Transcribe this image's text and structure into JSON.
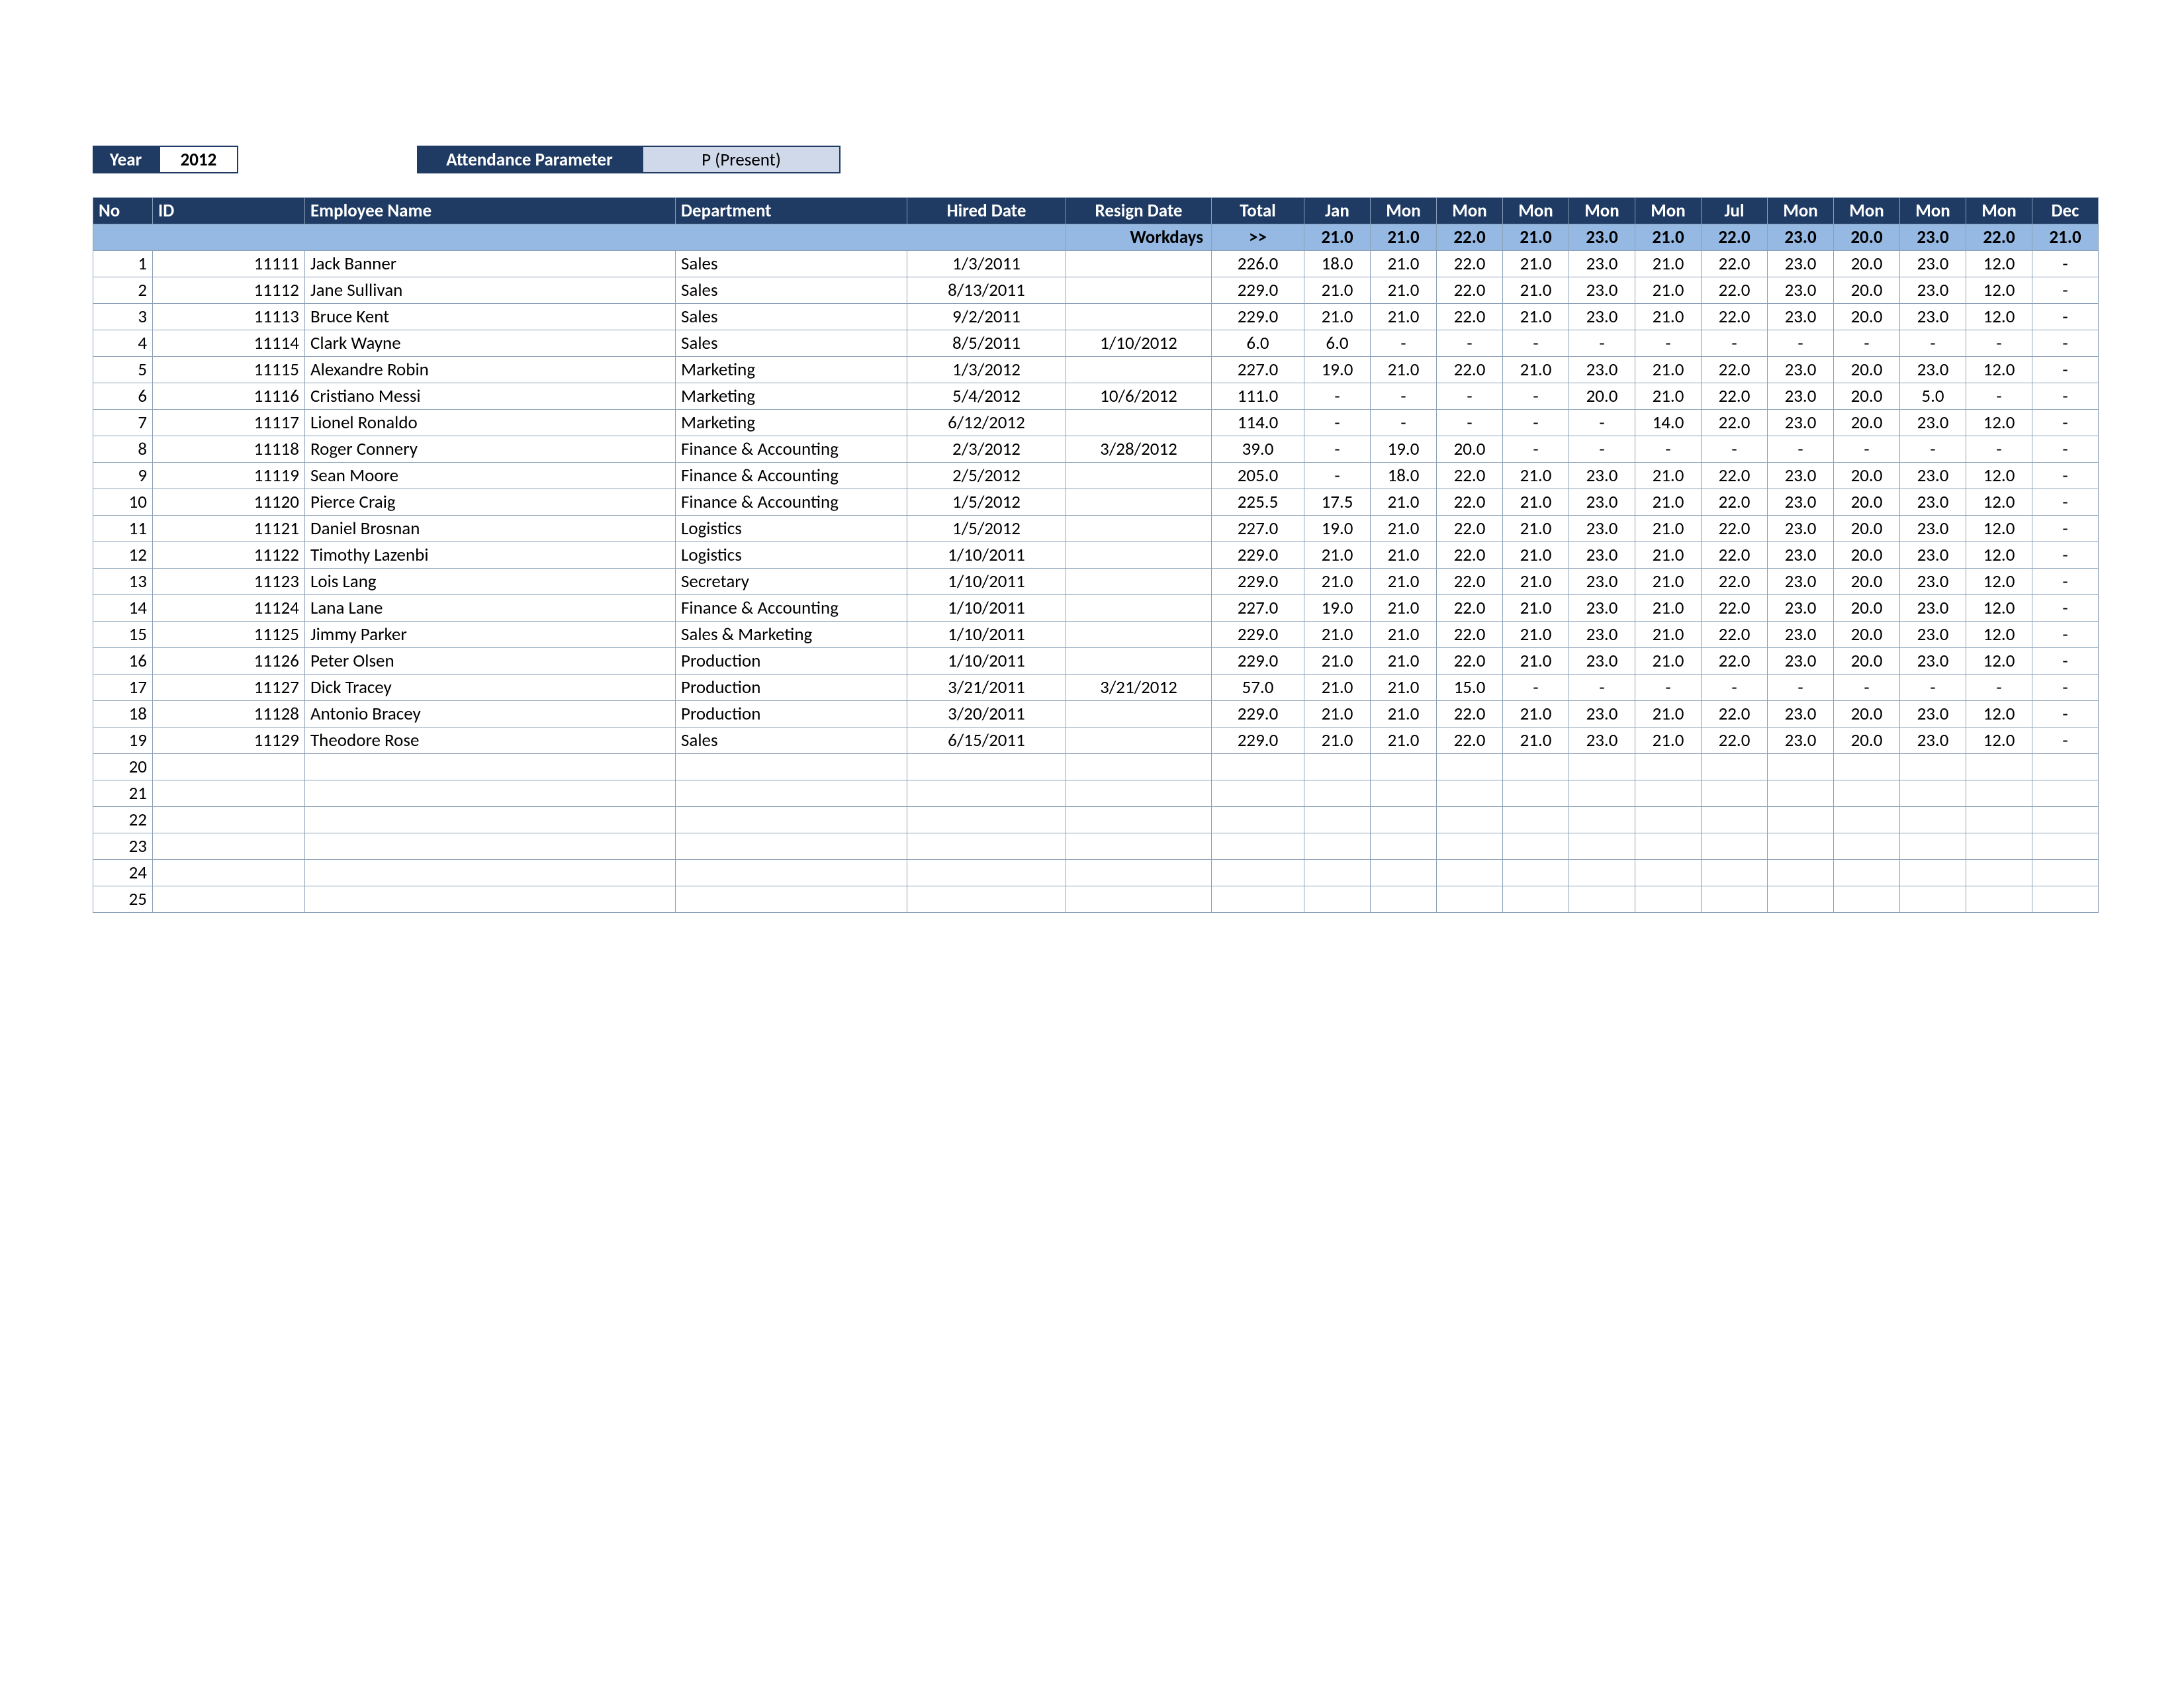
{
  "controls": {
    "year_label": "Year",
    "year_value": "2012",
    "attendance_label": "Attendance Parameter",
    "attendance_value": "P (Present)"
  },
  "columns": [
    "No",
    "ID",
    "Employee Name",
    "Department",
    "Hired Date",
    "Resign Date",
    "Total",
    "Jan",
    "Mon",
    "Mon",
    "Mon",
    "Mon",
    "Mon",
    "Jul",
    "Mon",
    "Mon",
    "Mon",
    "Mon",
    "Dec"
  ],
  "workdays": {
    "label": "Workdays",
    "total": ">>",
    "months": [
      "21.0",
      "21.0",
      "22.0",
      "21.0",
      "23.0",
      "21.0",
      "22.0",
      "23.0",
      "20.0",
      "23.0",
      "22.0",
      "21.0"
    ]
  },
  "rows": [
    {
      "no": 1,
      "id": "11111",
      "name": "Jack Banner",
      "dept": "Sales",
      "hired": "1/3/2011",
      "resign": "",
      "total": "226.0",
      "m": [
        "18.0",
        "21.0",
        "22.0",
        "21.0",
        "23.0",
        "21.0",
        "22.0",
        "23.0",
        "20.0",
        "23.0",
        "12.0",
        "-"
      ]
    },
    {
      "no": 2,
      "id": "11112",
      "name": "Jane Sullivan",
      "dept": "Sales",
      "hired": "8/13/2011",
      "resign": "",
      "total": "229.0",
      "m": [
        "21.0",
        "21.0",
        "22.0",
        "21.0",
        "23.0",
        "21.0",
        "22.0",
        "23.0",
        "20.0",
        "23.0",
        "12.0",
        "-"
      ]
    },
    {
      "no": 3,
      "id": "11113",
      "name": "Bruce Kent",
      "dept": "Sales",
      "hired": "9/2/2011",
      "resign": "",
      "total": "229.0",
      "m": [
        "21.0",
        "21.0",
        "22.0",
        "21.0",
        "23.0",
        "21.0",
        "22.0",
        "23.0",
        "20.0",
        "23.0",
        "12.0",
        "-"
      ]
    },
    {
      "no": 4,
      "id": "11114",
      "name": "Clark Wayne",
      "dept": "Sales",
      "hired": "8/5/2011",
      "resign": "1/10/2012",
      "total": "6.0",
      "m": [
        "6.0",
        "-",
        "-",
        "-",
        "-",
        "-",
        "-",
        "-",
        "-",
        "-",
        "-",
        "-"
      ]
    },
    {
      "no": 5,
      "id": "11115",
      "name": "Alexandre Robin",
      "dept": "Marketing",
      "hired": "1/3/2012",
      "resign": "",
      "total": "227.0",
      "m": [
        "19.0",
        "21.0",
        "22.0",
        "21.0",
        "23.0",
        "21.0",
        "22.0",
        "23.0",
        "20.0",
        "23.0",
        "12.0",
        "-"
      ]
    },
    {
      "no": 6,
      "id": "11116",
      "name": "Cristiano Messi",
      "dept": "Marketing",
      "hired": "5/4/2012",
      "resign": "10/6/2012",
      "total": "111.0",
      "m": [
        "-",
        "-",
        "-",
        "-",
        "20.0",
        "21.0",
        "22.0",
        "23.0",
        "20.0",
        "5.0",
        "-",
        "-"
      ]
    },
    {
      "no": 7,
      "id": "11117",
      "name": "Lionel Ronaldo",
      "dept": "Marketing",
      "hired": "6/12/2012",
      "resign": "",
      "total": "114.0",
      "m": [
        "-",
        "-",
        "-",
        "-",
        "-",
        "14.0",
        "22.0",
        "23.0",
        "20.0",
        "23.0",
        "12.0",
        "-"
      ]
    },
    {
      "no": 8,
      "id": "11118",
      "name": "Roger Connery",
      "dept": "Finance & Accounting",
      "hired": "2/3/2012",
      "resign": "3/28/2012",
      "total": "39.0",
      "m": [
        "-",
        "19.0",
        "20.0",
        "-",
        "-",
        "-",
        "-",
        "-",
        "-",
        "-",
        "-",
        "-"
      ]
    },
    {
      "no": 9,
      "id": "11119",
      "name": "Sean Moore",
      "dept": "Finance & Accounting",
      "hired": "2/5/2012",
      "resign": "",
      "total": "205.0",
      "m": [
        "-",
        "18.0",
        "22.0",
        "21.0",
        "23.0",
        "21.0",
        "22.0",
        "23.0",
        "20.0",
        "23.0",
        "12.0",
        "-"
      ]
    },
    {
      "no": 10,
      "id": "11120",
      "name": "Pierce Craig",
      "dept": "Finance & Accounting",
      "hired": "1/5/2012",
      "resign": "",
      "total": "225.5",
      "m": [
        "17.5",
        "21.0",
        "22.0",
        "21.0",
        "23.0",
        "21.0",
        "22.0",
        "23.0",
        "20.0",
        "23.0",
        "12.0",
        "-"
      ]
    },
    {
      "no": 11,
      "id": "11121",
      "name": "Daniel Brosnan",
      "dept": "Logistics",
      "hired": "1/5/2012",
      "resign": "",
      "total": "227.0",
      "m": [
        "19.0",
        "21.0",
        "22.0",
        "21.0",
        "23.0",
        "21.0",
        "22.0",
        "23.0",
        "20.0",
        "23.0",
        "12.0",
        "-"
      ]
    },
    {
      "no": 12,
      "id": "11122",
      "name": "Timothy Lazenbi",
      "dept": "Logistics",
      "hired": "1/10/2011",
      "resign": "",
      "total": "229.0",
      "m": [
        "21.0",
        "21.0",
        "22.0",
        "21.0",
        "23.0",
        "21.0",
        "22.0",
        "23.0",
        "20.0",
        "23.0",
        "12.0",
        "-"
      ]
    },
    {
      "no": 13,
      "id": "11123",
      "name": "Lois Lang",
      "dept": "Secretary",
      "hired": "1/10/2011",
      "resign": "",
      "total": "229.0",
      "m": [
        "21.0",
        "21.0",
        "22.0",
        "21.0",
        "23.0",
        "21.0",
        "22.0",
        "23.0",
        "20.0",
        "23.0",
        "12.0",
        "-"
      ]
    },
    {
      "no": 14,
      "id": "11124",
      "name": "Lana Lane",
      "dept": "Finance & Accounting",
      "hired": "1/10/2011",
      "resign": "",
      "total": "227.0",
      "m": [
        "19.0",
        "21.0",
        "22.0",
        "21.0",
        "23.0",
        "21.0",
        "22.0",
        "23.0",
        "20.0",
        "23.0",
        "12.0",
        "-"
      ]
    },
    {
      "no": 15,
      "id": "11125",
      "name": "Jimmy Parker",
      "dept": "Sales & Marketing",
      "hired": "1/10/2011",
      "resign": "",
      "total": "229.0",
      "m": [
        "21.0",
        "21.0",
        "22.0",
        "21.0",
        "23.0",
        "21.0",
        "22.0",
        "23.0",
        "20.0",
        "23.0",
        "12.0",
        "-"
      ]
    },
    {
      "no": 16,
      "id": "11126",
      "name": "Peter Olsen",
      "dept": "Production",
      "hired": "1/10/2011",
      "resign": "",
      "total": "229.0",
      "m": [
        "21.0",
        "21.0",
        "22.0",
        "21.0",
        "23.0",
        "21.0",
        "22.0",
        "23.0",
        "20.0",
        "23.0",
        "12.0",
        "-"
      ]
    },
    {
      "no": 17,
      "id": "11127",
      "name": "Dick Tracey",
      "dept": "Production",
      "hired": "3/21/2011",
      "resign": "3/21/2012",
      "total": "57.0",
      "m": [
        "21.0",
        "21.0",
        "15.0",
        "-",
        "-",
        "-",
        "-",
        "-",
        "-",
        "-",
        "-",
        "-"
      ]
    },
    {
      "no": 18,
      "id": "11128",
      "name": "Antonio Bracey",
      "dept": "Production",
      "hired": "3/20/2011",
      "resign": "",
      "total": "229.0",
      "m": [
        "21.0",
        "21.0",
        "22.0",
        "21.0",
        "23.0",
        "21.0",
        "22.0",
        "23.0",
        "20.0",
        "23.0",
        "12.0",
        "-"
      ]
    },
    {
      "no": 19,
      "id": "11129",
      "name": "Theodore Rose",
      "dept": "Sales",
      "hired": "6/15/2011",
      "resign": "",
      "total": "229.0",
      "m": [
        "21.0",
        "21.0",
        "22.0",
        "21.0",
        "23.0",
        "21.0",
        "22.0",
        "23.0",
        "20.0",
        "23.0",
        "12.0",
        "-"
      ]
    }
  ],
  "empty_rows": [
    20,
    21,
    22,
    23,
    24,
    25
  ]
}
